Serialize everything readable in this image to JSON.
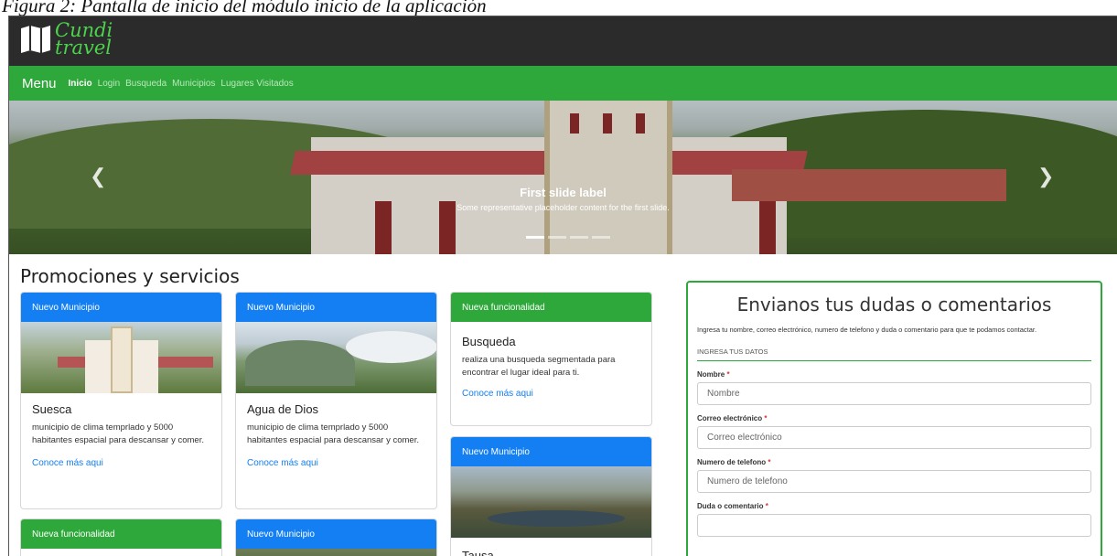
{
  "caption": "Figura 2: Pantalla de inicio del módulo inicio de la aplicación",
  "brand": {
    "line1": "Cundi",
    "line2": "travel",
    "icon": "map-icon"
  },
  "navbar": {
    "brand": "Menu",
    "links": [
      "Inicio",
      "Login",
      "Busqueda",
      "Municipios",
      "Lugares Visitados"
    ]
  },
  "carousel": {
    "title": "First slide label",
    "text": "Some representative placeholder content for the first slide.",
    "prev_icon": "chevron-left-icon",
    "next_icon": "chevron-right-icon",
    "slide_count": 4,
    "active_slide": 1
  },
  "promotions": {
    "heading": "Promociones y servicios",
    "cards": [
      {
        "header": "Nuevo Municipio",
        "title": "Suesca",
        "text": "municipio de clima temprlado y 5000 habitantes espacial para descansar y comer.",
        "link": "Conoce más aqui"
      },
      {
        "header": "Nuevo Municipio",
        "title": "Agua de Dios",
        "text": "municipio de clima temprlado y 5000 habitantes espacial para descansar y comer.",
        "link": "Conoce más aqui"
      },
      {
        "header": "Nueva funcionalidad",
        "title": "Busqueda",
        "text": "realiza una busqueda segmentada para encontrar el lugar ideal para ti.",
        "link": "Conoce más aqui"
      },
      {
        "header": "Nuevo Municipio",
        "title": "Tausa"
      },
      {
        "header": "Nueva funcionalidad"
      },
      {
        "header": "Nuevo Municipio"
      }
    ]
  },
  "contact_form": {
    "title": "Envianos tus dudas o comentarios",
    "intro": "Ingresa tu nombre, correo electrónico, numero de telefono y duda o comentario para que te podamos contactar.",
    "section": "INGRESA TUS DATOS",
    "fields": [
      {
        "label": "Nombre",
        "placeholder": "Nombre"
      },
      {
        "label": "Correo electrónico",
        "placeholder": "Correo electrónico"
      },
      {
        "label": "Numero de telefono",
        "placeholder": "Numero de telefono"
      },
      {
        "label": "Duda o comentario",
        "placeholder": ""
      }
    ],
    "required_mark": "*"
  },
  "colors": {
    "green": "#2ea83a",
    "blue": "#137ff2",
    "topbar": "#2b2b2b"
  }
}
